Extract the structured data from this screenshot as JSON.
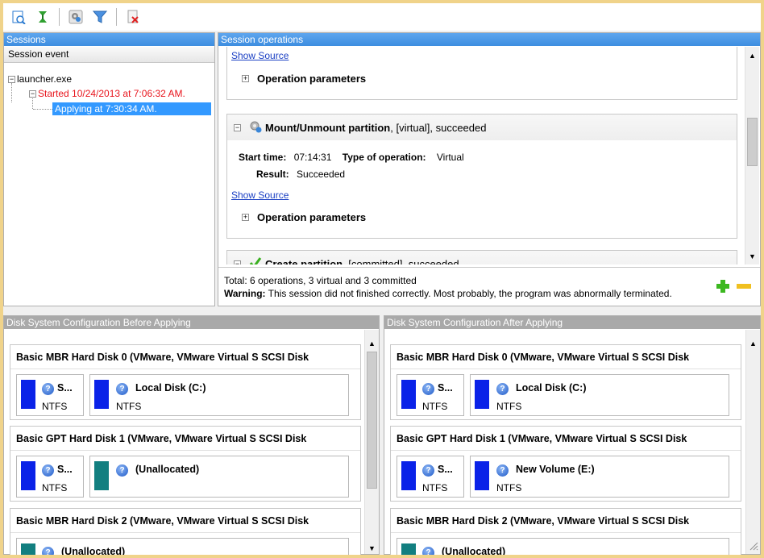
{
  "toolbar": {
    "buttons": [
      "report-icon",
      "apply-icon",
      "settings-icon",
      "filter-icon",
      "delete-icon"
    ]
  },
  "sessions": {
    "header": "Sessions",
    "column": "Session event",
    "tree": {
      "root": "launcher.exe",
      "child": "Started 10/24/2013 at 7:06:32 AM.",
      "leaf": "Applying at 7:30:34 AM."
    }
  },
  "ops": {
    "header": "Session operations",
    "show_source": "Show Source",
    "op_params": "Operation parameters",
    "op2": {
      "name": "Mount/Unmount partition",
      "suffix": ", [virtual], succeeded",
      "start_label": "Start time:",
      "start_value": "07:14:31",
      "type_label": "Type of operation:",
      "type_value": "Virtual",
      "result_label": "Result:",
      "result_value": "Succeeded"
    },
    "op3": {
      "name": "Create partition",
      "suffix": ", [committed], succeeded"
    },
    "total": "Total: 6 operations, 3 virtual and 3 committed",
    "warning_label": "Warning:",
    "warning_text": " This session did not finished correctly. Most probably, the program was abnormally terminated."
  },
  "before": {
    "header": "Disk System Configuration Before Applying",
    "disk0": "Basic MBR Hard Disk 0 (VMware, VMware Virtual S SCSI Disk",
    "disk1": "Basic GPT Hard Disk 1 (VMware, VMware Virtual S SCSI Disk",
    "disk2": "Basic MBR Hard Disk 2 (VMware, VMware Virtual S SCSI Disk",
    "small_part": "S...",
    "fs": "NTFS",
    "local_c": "Local Disk (C:)",
    "unalloc": "(Unallocated)"
  },
  "after": {
    "header": "Disk System Configuration After Applying",
    "disk0": "Basic MBR Hard Disk 0 (VMware, VMware Virtual S SCSI Disk",
    "disk1": "Basic GPT Hard Disk 1 (VMware, VMware Virtual S SCSI Disk",
    "disk2": "Basic MBR Hard Disk 2 (VMware, VMware Virtual S SCSI Disk",
    "small_part": "S...",
    "fs": "NTFS",
    "local_c": "Local Disk (C:)",
    "new_vol": "New Volume (E:)",
    "unalloc": "(Unallocated)"
  },
  "colors": {
    "selection": "#3399ff",
    "started_text": "#e8141c",
    "partition_blue": "#0a22e8",
    "partition_teal": "#127f80",
    "plus_green": "#3cb820",
    "minus_yellow": "#f0c020"
  }
}
